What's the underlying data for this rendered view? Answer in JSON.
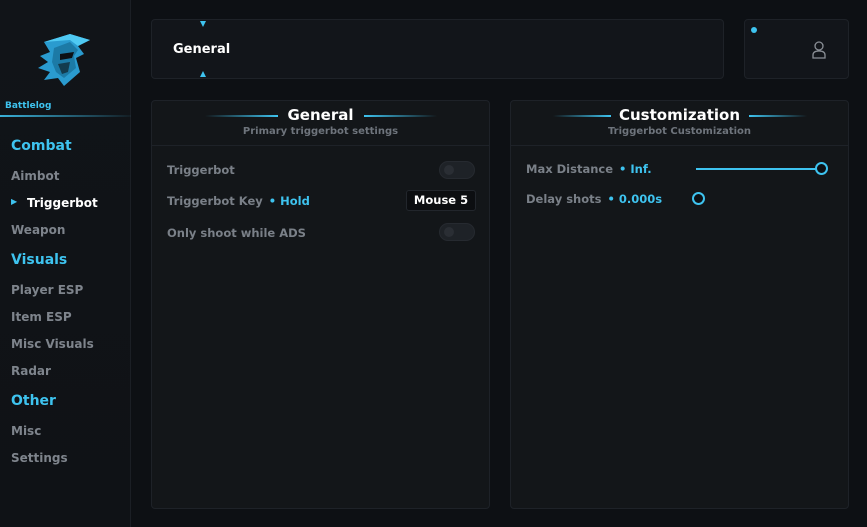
{
  "sidebar": {
    "brand": "Battlelog",
    "sections": [
      {
        "label": "Combat",
        "items": [
          {
            "label": "Aimbot"
          },
          {
            "label": "Triggerbot",
            "active": true
          },
          {
            "label": "Weapon"
          }
        ]
      },
      {
        "label": "Visuals",
        "items": [
          {
            "label": "Player ESP"
          },
          {
            "label": "Item ESP"
          },
          {
            "label": "Misc Visuals"
          },
          {
            "label": "Radar"
          }
        ]
      },
      {
        "label": "Other",
        "items": [
          {
            "label": "Misc"
          },
          {
            "label": "Settings"
          }
        ]
      }
    ]
  },
  "topbar": {
    "title": "General"
  },
  "user": {
    "icon": "user-icon"
  },
  "panels": {
    "general": {
      "title": "General",
      "subtitle": "Primary triggerbot settings",
      "rows": {
        "triggerbot": {
          "label": "Triggerbot",
          "enabled": false
        },
        "key": {
          "label": "Triggerbot Key",
          "mode": "Hold",
          "bind": "Mouse 5"
        },
        "ads": {
          "label": "Only shoot while ADS",
          "enabled": false
        }
      }
    },
    "custom": {
      "title": "Customization",
      "subtitle": "Triggerbot Customization",
      "rows": {
        "maxdist": {
          "label": "Max Distance",
          "value": "Inf.",
          "fraction": 1.0
        },
        "delay": {
          "label": "Delay shots",
          "value": "0.000s",
          "fraction": 0.0
        }
      }
    }
  },
  "colors": {
    "accent": "#3ec3ef",
    "background": "#0d1014",
    "panel": "#131619"
  }
}
